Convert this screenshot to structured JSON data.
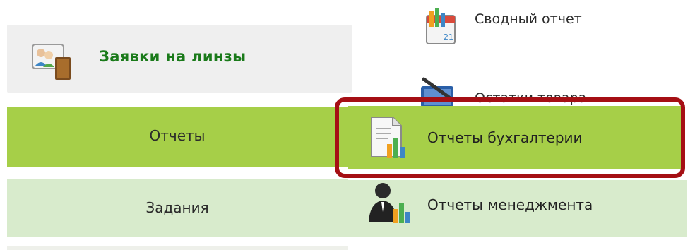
{
  "menu": {
    "lenses_label": "Заявки на линзы",
    "reports_label": "Отчеты",
    "tasks_label": "Задания"
  },
  "submenu": {
    "summary_label": "Сводный отчет",
    "hidden_label": "Остатки товара",
    "accounting_label": "Отчеты бухгалтерии",
    "management_label": "Отчеты менеджмента"
  },
  "icons": {
    "lenses": "contact-card-icon",
    "summary": "calendar-chart-icon",
    "hidden": "tablet-pen-icon",
    "accounting": "document-chart-icon",
    "management": "person-chart-icon"
  },
  "colors": {
    "reports_active": "#a6cf48",
    "tasks_inactive": "#d8ebcc",
    "lenses_text": "#1a7a1a",
    "highlight_border": "#a50f14"
  }
}
